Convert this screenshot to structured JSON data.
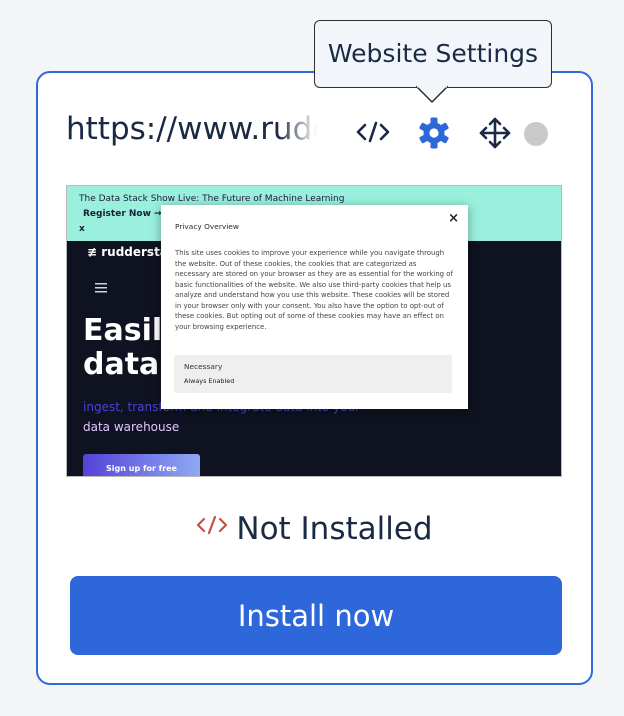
{
  "widget": {
    "url": "https://www.rudderstack.com",
    "tooltip": "Website Settings",
    "status_text": "Not Installed",
    "install_label": "Install now"
  },
  "toolbar": {
    "icons": [
      "code-icon",
      "gear-icon",
      "move-icon",
      "status-dot"
    ]
  },
  "preview": {
    "banner_title": "The Data Stack Show Live: The Future of Machine Learning",
    "banner_register": "Register Now →",
    "banner_close": "x",
    "logo": "rudderstack",
    "hero": "Easily\ndata w",
    "hero_sub1": "ingest, transform and integrate data into your",
    "hero_sub2": "data warehouse",
    "signup": "Sign up for free",
    "modal": {
      "title": "Privacy Overview",
      "close": "×",
      "body": "This site uses cookies to improve your experience while you navigate through the website. Out of these cookies, the cookies that are categorized as necessary are stored on your browser as they are as essential for the working of basic functionalities of the website. We also use third-party cookies that help us analyze and understand how you use this website. These cookies will be stored in your browser only with your consent. You also have the option to opt-out of these cookies. But opting out of some of these cookies may have an effect on your browsing experience.",
      "necessary_label": "Necessary",
      "necessary_status": "Always Enabled"
    }
  },
  "colors": {
    "accent": "#2d67d9",
    "card_border": "#2f6bd8",
    "not_installed_icon": "#c0504d",
    "status_dot": "#c9c9c9",
    "text": "#1b2a44"
  }
}
